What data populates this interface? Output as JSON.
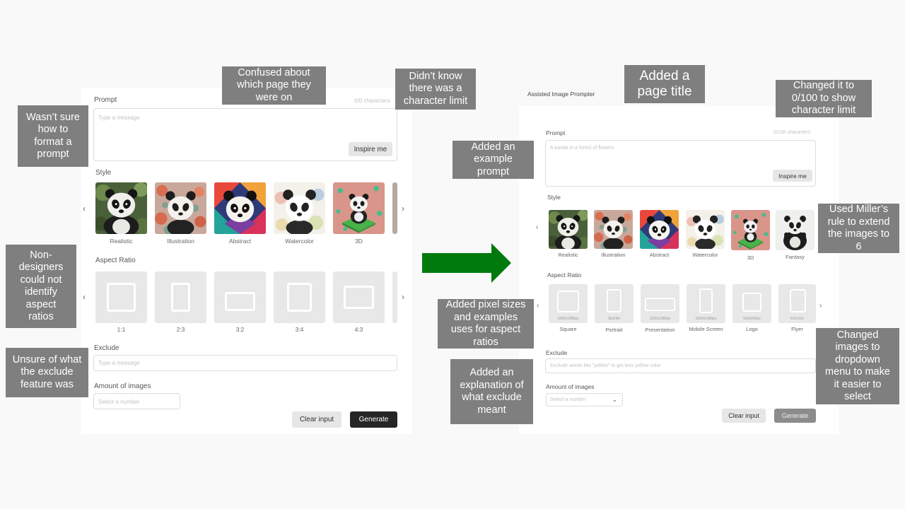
{
  "colors": {
    "page_bg": "#f9f9f9",
    "panel_bg": "#ffffff",
    "annotation_bg": "#7f7f7f",
    "arrow_green": "#007a0c",
    "dark_button": "#262626",
    "light_button": "#e6e6e6",
    "generate_disabled": "#8c8c8c"
  },
  "before": {
    "prompt_label": "Prompt",
    "char_count": "0/0 characters",
    "prompt_placeholder": "Type a message",
    "inspire_label": "Inspire me",
    "style_label": "Style",
    "styles": [
      "Realistic",
      "Illustration",
      "Abstract",
      "Watercolor",
      "3D"
    ],
    "aspect_label": "Aspect Ratio",
    "ratios": [
      "1:1",
      "2:3",
      "3:2",
      "3:4",
      "4:3"
    ],
    "exclude_label": "Exclude",
    "exclude_placeholder": "Type a message",
    "amount_label": "Amount of images",
    "amount_placeholder": "Select a number",
    "clear_label": "Clear input",
    "generate_label": "Generate"
  },
  "after": {
    "page_title": "Assisted Image Prompter",
    "prompt_label": "Prompt",
    "char_count": "0/100 characters",
    "prompt_placeholder": "A panda in a forest of flowers",
    "inspire_label": "Inspire me",
    "style_label": "Style",
    "styles": [
      "Realistic",
      "Illustration",
      "Abstract",
      "Watercolor",
      "3D",
      "Fantasy"
    ],
    "aspect_label": "Aspect Ratio",
    "ratios": [
      {
        "size": "1080x1080px",
        "name": "Square"
      },
      {
        "size": "16x24in",
        "name": "Portrait"
      },
      {
        "size": "1920x1080px",
        "name": "Presentation"
      },
      {
        "size": "1920x1080px",
        "name": "Mobile Screen"
      },
      {
        "size": "500x500px",
        "name": "Logo"
      },
      {
        "size": "8.5x11in",
        "name": "Flyer"
      }
    ],
    "exclude_label": "Exclude",
    "exclude_placeholder": "Exclude words like \"yellow\" to get less yellow color",
    "amount_label": "Amount of images",
    "amount_placeholder": "Select a number",
    "clear_label": "Clear input",
    "generate_label": "Generate"
  },
  "annotations": {
    "confused_page": "Confused about\nwhich page they\nwere on",
    "char_limit": "Didn’t know\nthere was a\ncharacter limit",
    "format_prompt": "Wasn’t sure\nhow to\nformat a\nprompt",
    "aspect_ratios": "Non-\ndesigners\ncould not\nidentify\naspect\nratios",
    "exclude_feature": "Unsure of what\nthe exclude\nfeature was",
    "page_title": "Added a\npage title",
    "changed_limit": "Changed it to\n0/100 to show\ncharacter limit",
    "example_prompt": "Added an\nexample\nprompt",
    "millers_rule": "Used Miller’s\nrule to extend\nthe images to\n6",
    "pixel_sizes": "Added pixel sizes\nand examples\nuses for aspect\nratios",
    "exclude_explain": "Added an\nexplanation of\nwhat exclude\nmeant",
    "dropdown": "Changed\nimages to\ndropdown\nmenu to make\nit easier to\nselect"
  },
  "icons": {
    "prev": "chevron-left-icon",
    "next": "chevron-right-icon",
    "dropdown": "chevron-down-icon",
    "arrow": "right-arrow-icon"
  }
}
